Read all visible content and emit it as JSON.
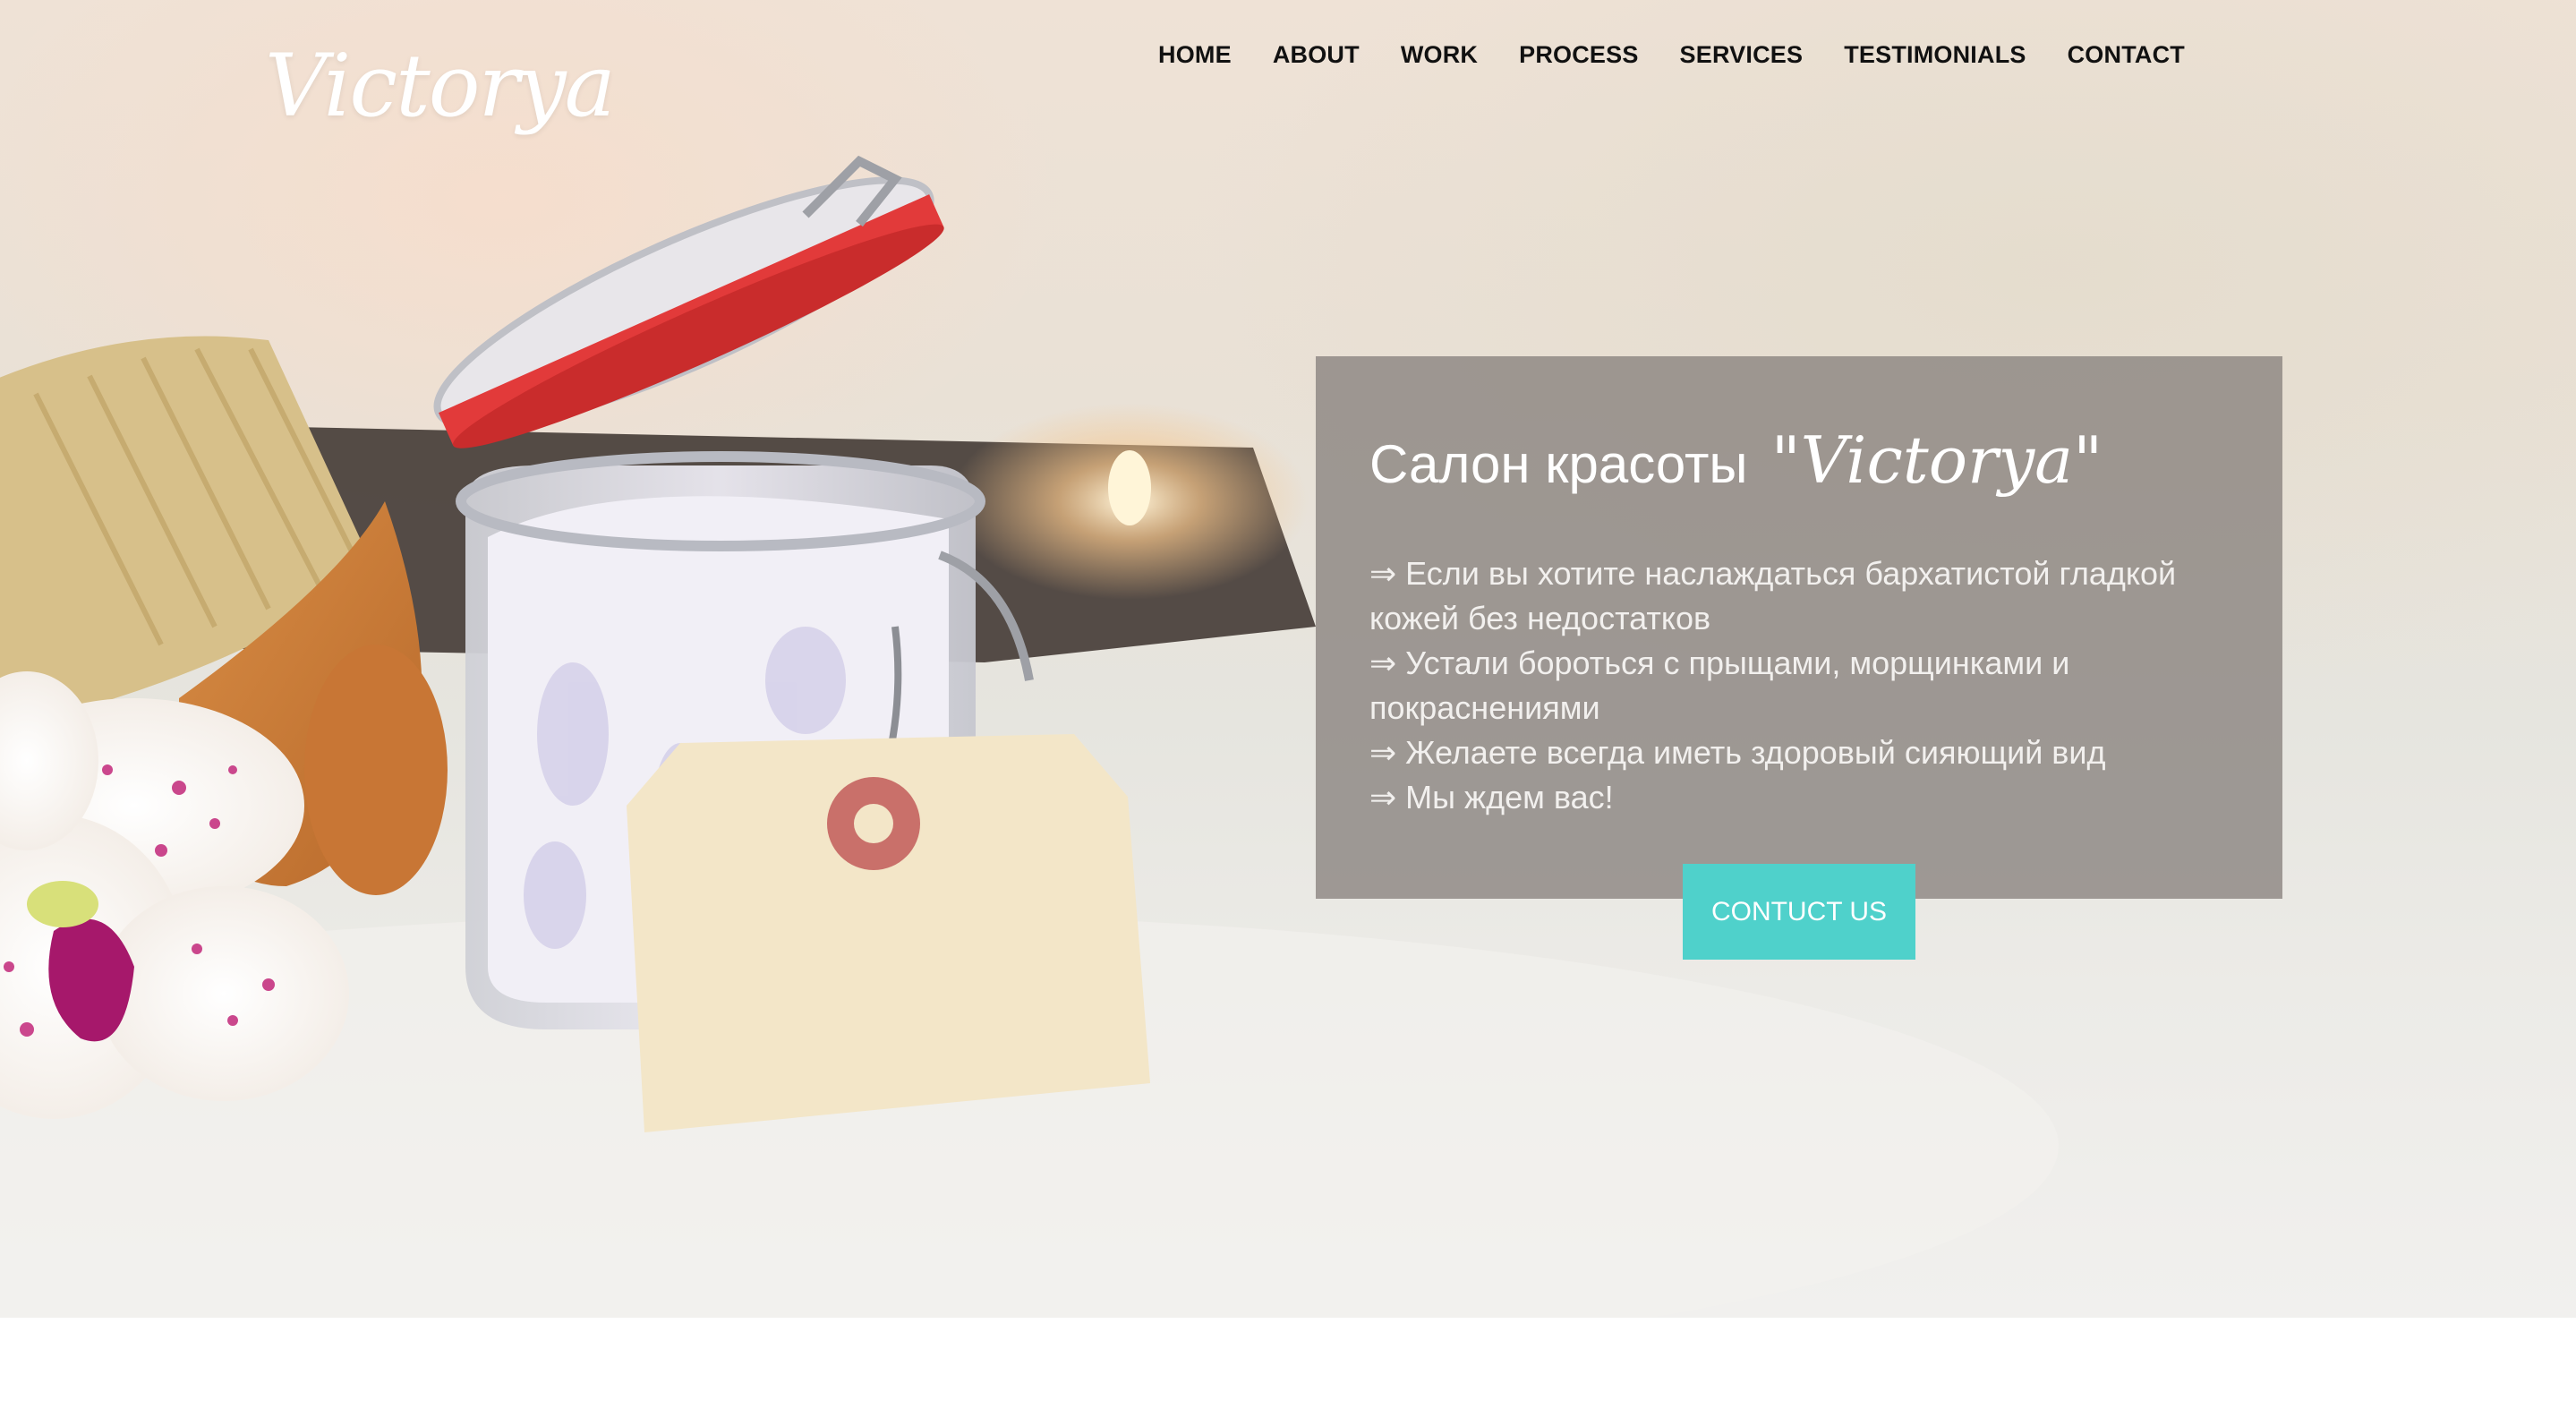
{
  "brand": {
    "logo_text": "Victorya"
  },
  "nav": {
    "items": [
      {
        "label": "HOME"
      },
      {
        "label": "ABOUT"
      },
      {
        "label": "WORK"
      },
      {
        "label": "PROCESS"
      },
      {
        "label": "SERVICES"
      },
      {
        "label": "TESTIMONIALS"
      },
      {
        "label": "CONTACT"
      }
    ]
  },
  "hero": {
    "title_plain": "Салон красоты",
    "title_script": "\"Victorya\"",
    "bullets": [
      "⇒ Если вы хотите наслаждаться бархатистой гладкой кожей без недостатков",
      "⇒ Устали бороться с прыщами, морщинками и покраснениями",
      "⇒ Желаете всегда иметь здоровый сияющий вид",
      "⇒ Мы ждем вас!"
    ],
    "cta_label": "CONTUCT US"
  },
  "colors": {
    "accent": "#4fd1cb",
    "panel": "#8a857f",
    "jar_lid_seal": "#e23a3a",
    "tag": "#f3e6c8",
    "orchid_spots": "#c2287a"
  },
  "images": {
    "hero_background": "spa-jar-brush-orchid-candle"
  }
}
